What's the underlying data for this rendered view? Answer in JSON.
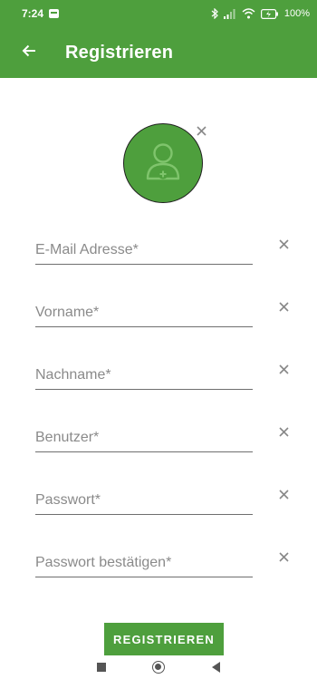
{
  "status_bar": {
    "time": "7:24",
    "battery": "100%",
    "icons": [
      "notification-icon",
      "bluetooth-icon",
      "signal-icon",
      "wifi-icon",
      "battery-icon"
    ]
  },
  "app_bar": {
    "title": "Registrieren",
    "back_icon": "arrow-back-icon"
  },
  "avatar": {
    "icon": "add-person-icon",
    "clear_icon": "close-icon"
  },
  "form": {
    "fields": [
      {
        "placeholder": "E-Mail Adresse*",
        "value": ""
      },
      {
        "placeholder": "Vorname*",
        "value": ""
      },
      {
        "placeholder": "Nachname*",
        "value": ""
      },
      {
        "placeholder": "Benutzer*",
        "value": ""
      },
      {
        "placeholder": "Passwort*",
        "value": ""
      },
      {
        "placeholder": "Passwort bestätigen*",
        "value": ""
      }
    ],
    "clear_icon": "close-icon",
    "submit_label": "REGISTRIEREN"
  },
  "nav_bar": {
    "icons": [
      "recents-icon",
      "home-icon",
      "back-icon"
    ]
  },
  "colors": {
    "primary": "#4e9f3d",
    "on_primary": "#ffffff",
    "divider": "#6f6f6f",
    "placeholder": "#8a8a8a",
    "icon_gray": "#888888"
  }
}
